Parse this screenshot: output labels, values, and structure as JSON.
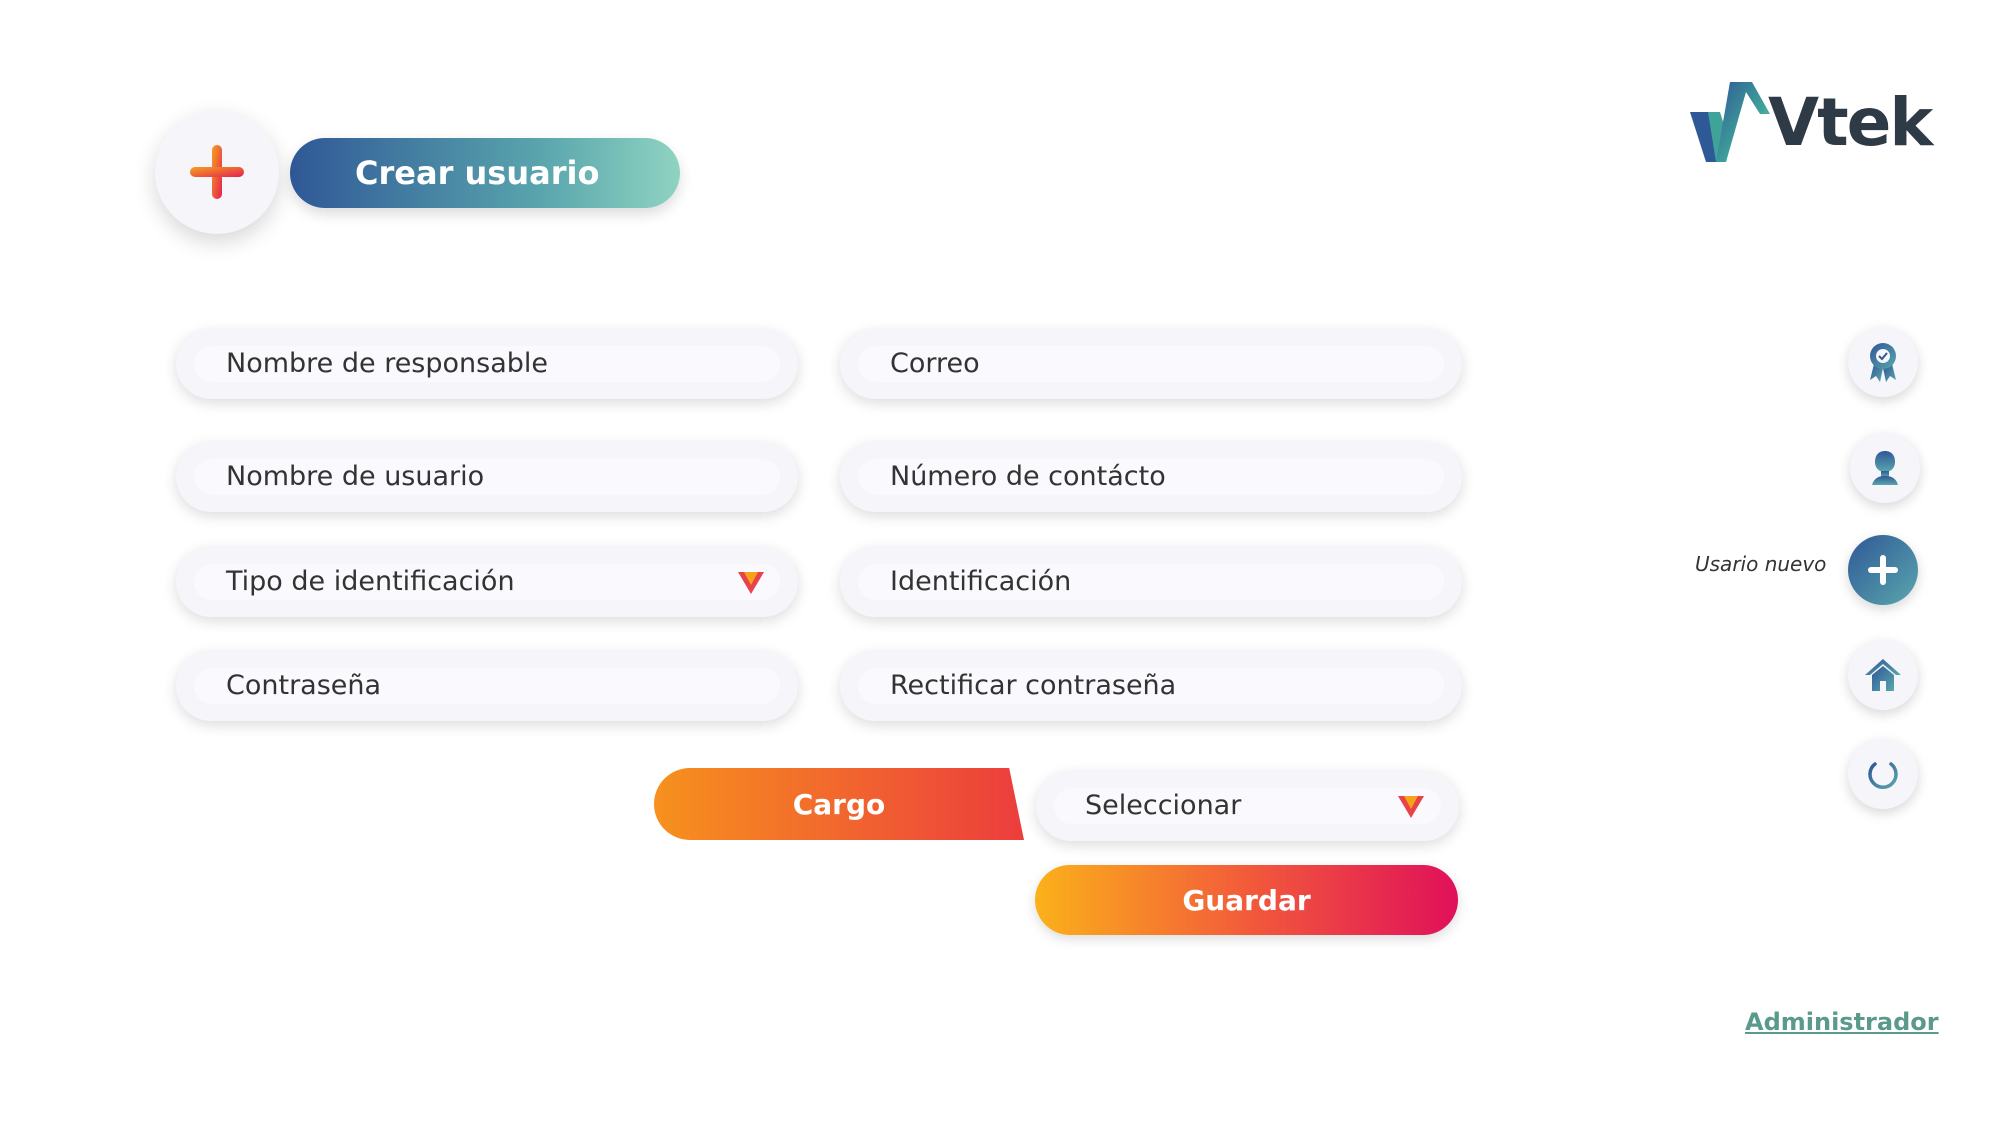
{
  "header": {
    "title": "Crear usuario",
    "add_icon": "plus-icon"
  },
  "logo": {
    "text": "Vtek"
  },
  "form": {
    "responsible_name": {
      "placeholder": "Nombre de responsable"
    },
    "email": {
      "placeholder": "Correo"
    },
    "username": {
      "placeholder": "Nombre de usuario"
    },
    "contact_number": {
      "placeholder": "Número de contácto"
    },
    "id_type": {
      "placeholder": "Tipo de identificación"
    },
    "identification": {
      "placeholder": "Identificación"
    },
    "password": {
      "placeholder": "Contraseña"
    },
    "confirm_password": {
      "placeholder": "Rectificar contraseña"
    },
    "role_label": "Cargo",
    "role_select": {
      "value": "Seleccionar"
    },
    "save_label": "Guardar"
  },
  "sidebar": {
    "items": [
      {
        "icon": "award-icon"
      },
      {
        "icon": "user-icon"
      },
      {
        "icon": "plus-icon",
        "label": "Usario nuevo",
        "active": true
      },
      {
        "icon": "home-icon"
      },
      {
        "icon": "power-icon"
      }
    ]
  },
  "footer": {
    "user_link": "Administrador"
  },
  "colors": {
    "accent_blue": "#2f5896",
    "accent_teal": "#8fd3c1",
    "accent_orange": "#f7911e",
    "accent_red": "#e0105a"
  }
}
